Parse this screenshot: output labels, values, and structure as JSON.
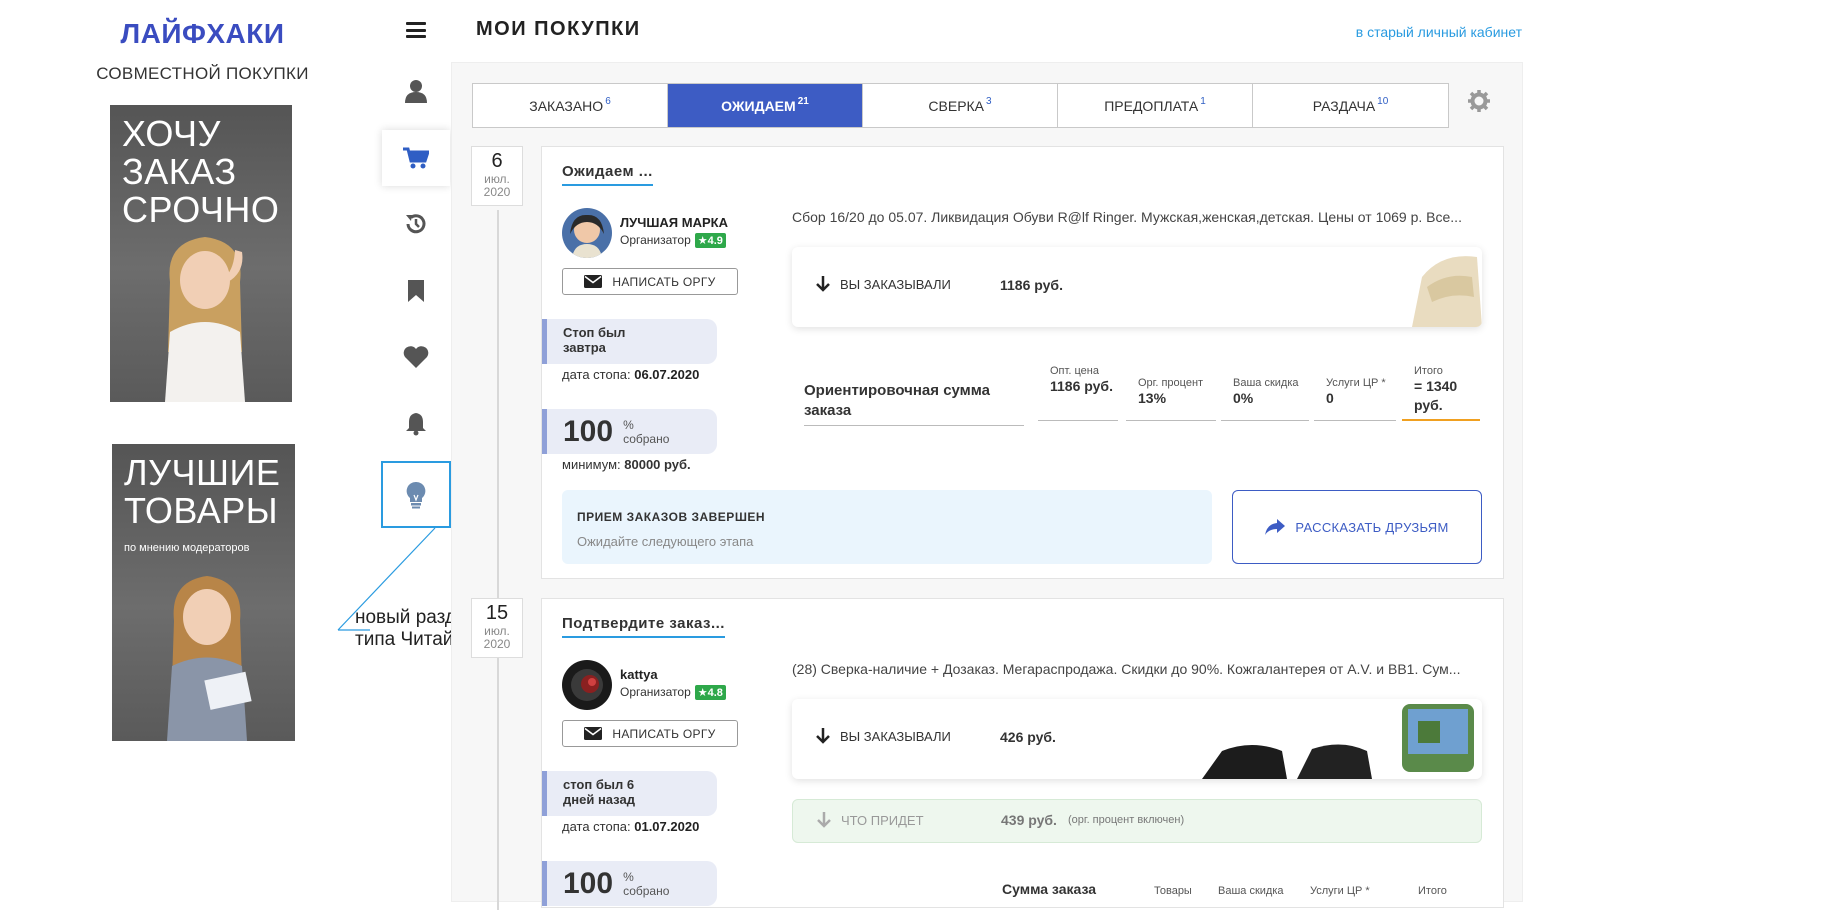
{
  "brand": {
    "title": "ЛАЙФХАКИ",
    "subtitle": "СОВМЕСТНОЙ ПОКУПКИ"
  },
  "promos": [
    {
      "text_lines": [
        "ХОЧУ",
        "ЗАКАЗ",
        "СРОЧНО"
      ],
      "small": ""
    },
    {
      "text_lines": [
        "ЛУЧШИЕ",
        "ТОВАРЫ"
      ],
      "small": "по мнению модераторов"
    }
  ],
  "annotation": {
    "line1": "новый раздел",
    "line2": "типа ЧитайСП"
  },
  "nav": [
    "menu-icon",
    "user-icon",
    "cart-icon",
    "history-icon",
    "bookmark-icon",
    "heart-icon",
    "bell-icon",
    "lightbulb-icon"
  ],
  "header": {
    "title": "МОИ ПОКУПКИ",
    "old_cabinet_link": "в старый личный кабинет"
  },
  "tabs": [
    {
      "label": "ЗАКАЗАНО",
      "count": "6"
    },
    {
      "label": "ОЖИДАЕМ",
      "count": "21"
    },
    {
      "label": "СВЕРКА",
      "count": "3"
    },
    {
      "label": "ПРЕДОПЛАТА",
      "count": "1"
    },
    {
      "label": "РАЗДАЧА",
      "count": "10"
    }
  ],
  "active_tab": "ОЖИДАЕМ",
  "cards": [
    {
      "date": {
        "day": "6",
        "month": "июл.",
        "year": "2020"
      },
      "title": "Ожидаем ...",
      "org_name": "ЛУЧШАЯ МАРКА",
      "org_role": "Организатор",
      "rating": "★4.9",
      "write_label": "НАПИСАТЬ ОРГУ",
      "stop_line1": "Стоп был",
      "stop_line2": "завтра",
      "stop_date_label": "дата стопа:",
      "stop_date": "06.07.2020",
      "percent": "100",
      "percent_sign": "%",
      "percent_label": "собрано",
      "minimum_label": "минимум:",
      "minimum": "80000 руб.",
      "lot_desc": "Сбор 16/20 до 05.07. Ликвидация Обуви R@lf Ringer. Мужская,женская,детская. Цены от 1069 р. Все...",
      "ordered_label": "ВЫ ЗАКАЗЫВАЛИ",
      "ordered_price": "1186 руб.",
      "sum_title": "Ориентировочная сумма заказа",
      "sum_cols": [
        {
          "h": "Опт. цена",
          "v": "1186 руб."
        },
        {
          "h": "Орг. процент",
          "v": "13%"
        },
        {
          "h": "Ваша скидка",
          "v": "0%"
        },
        {
          "h": "Услуги ЦР *",
          "v": "0"
        },
        {
          "h": "Итого",
          "v": "= 1340 руб."
        }
      ],
      "accept_title": "ПРИЕМ ЗАКАЗОВ ЗАВЕРШЕН",
      "accept_note": "Ожидайте следующего этапа",
      "share_label": "РАССКАЗАТЬ ДРУЗЬЯМ"
    },
    {
      "date": {
        "day": "15",
        "month": "июл.",
        "year": "2020"
      },
      "title": "Подтвердите заказ...",
      "org_name": "kattya",
      "org_role": "Организатор",
      "rating": "★4.8",
      "write_label": "НАПИСАТЬ ОРГУ",
      "stop_line1": "стоп был 6",
      "stop_line2": "дней назад",
      "stop_date_label": "дата стопа:",
      "stop_date": "01.07.2020",
      "percent": "100",
      "percent_sign": "%",
      "percent_label": "собрано",
      "lot_desc": "(28) Сверка-наличие + Дозаказ. Мегараспродажа. Скидки до 90%. Кожгалантерея от A.V. и BB1. Сум...",
      "ordered_label": "ВЫ ЗАКАЗЫВАЛИ",
      "ordered_price": "426 руб.",
      "arrive_label": "ЧТО ПРИДЕТ",
      "arrive_price": "439 руб.",
      "arrive_note": "(орг. процент включен)",
      "sum_title": "Сумма заказа",
      "sum_heads": [
        "Товары",
        "Ваша скидка",
        "Услуги ЦР *",
        "Итого"
      ]
    }
  ],
  "colors": {
    "accent": "#3d5cc4",
    "link": "#2a9be0",
    "rating": "#2ea84a",
    "total_underline": "#f0a020"
  }
}
